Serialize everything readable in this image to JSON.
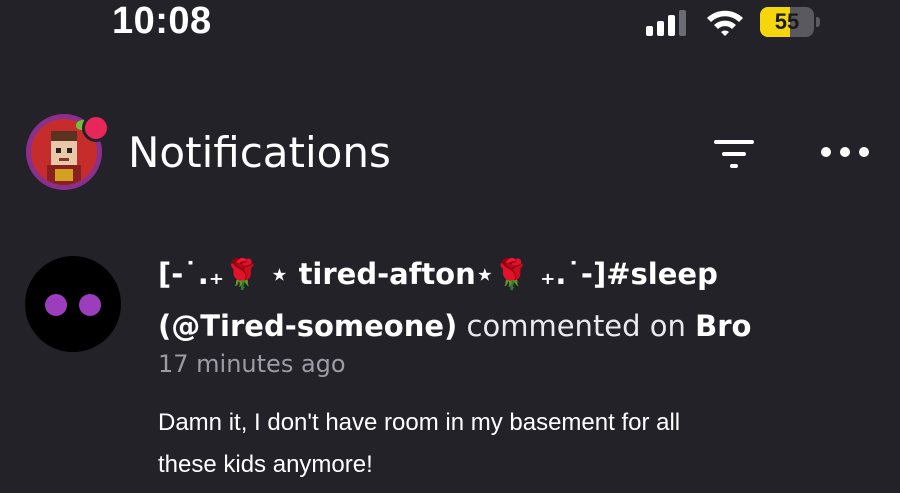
{
  "status_bar": {
    "time": "10:08",
    "battery_level": "55",
    "battery_fraction": 0.55,
    "icons": [
      "signal-icon",
      "wifi-icon",
      "battery-icon"
    ]
  },
  "header": {
    "title": "Notifications",
    "icons": [
      "filter-icon",
      "more-options-icon"
    ]
  },
  "notification": {
    "display_name": "[-˙.₊🌹 ⋆ tired-afton⋆🌹 ₊.˙-]#sleep",
    "handle": "(@Tired-someone)",
    "verb": " commented on ",
    "target": "Bro",
    "timestamp": "17 minutes ago",
    "comment": "Damn it, I don't have room in my basement for all these kids anymore!"
  },
  "colors": {
    "background": "#232229",
    "text_primary": "#ffffff",
    "text_secondary": "#9c9ca6",
    "battery_fill": "#f5d50b",
    "avatar_eye": "#9b3dbd"
  }
}
